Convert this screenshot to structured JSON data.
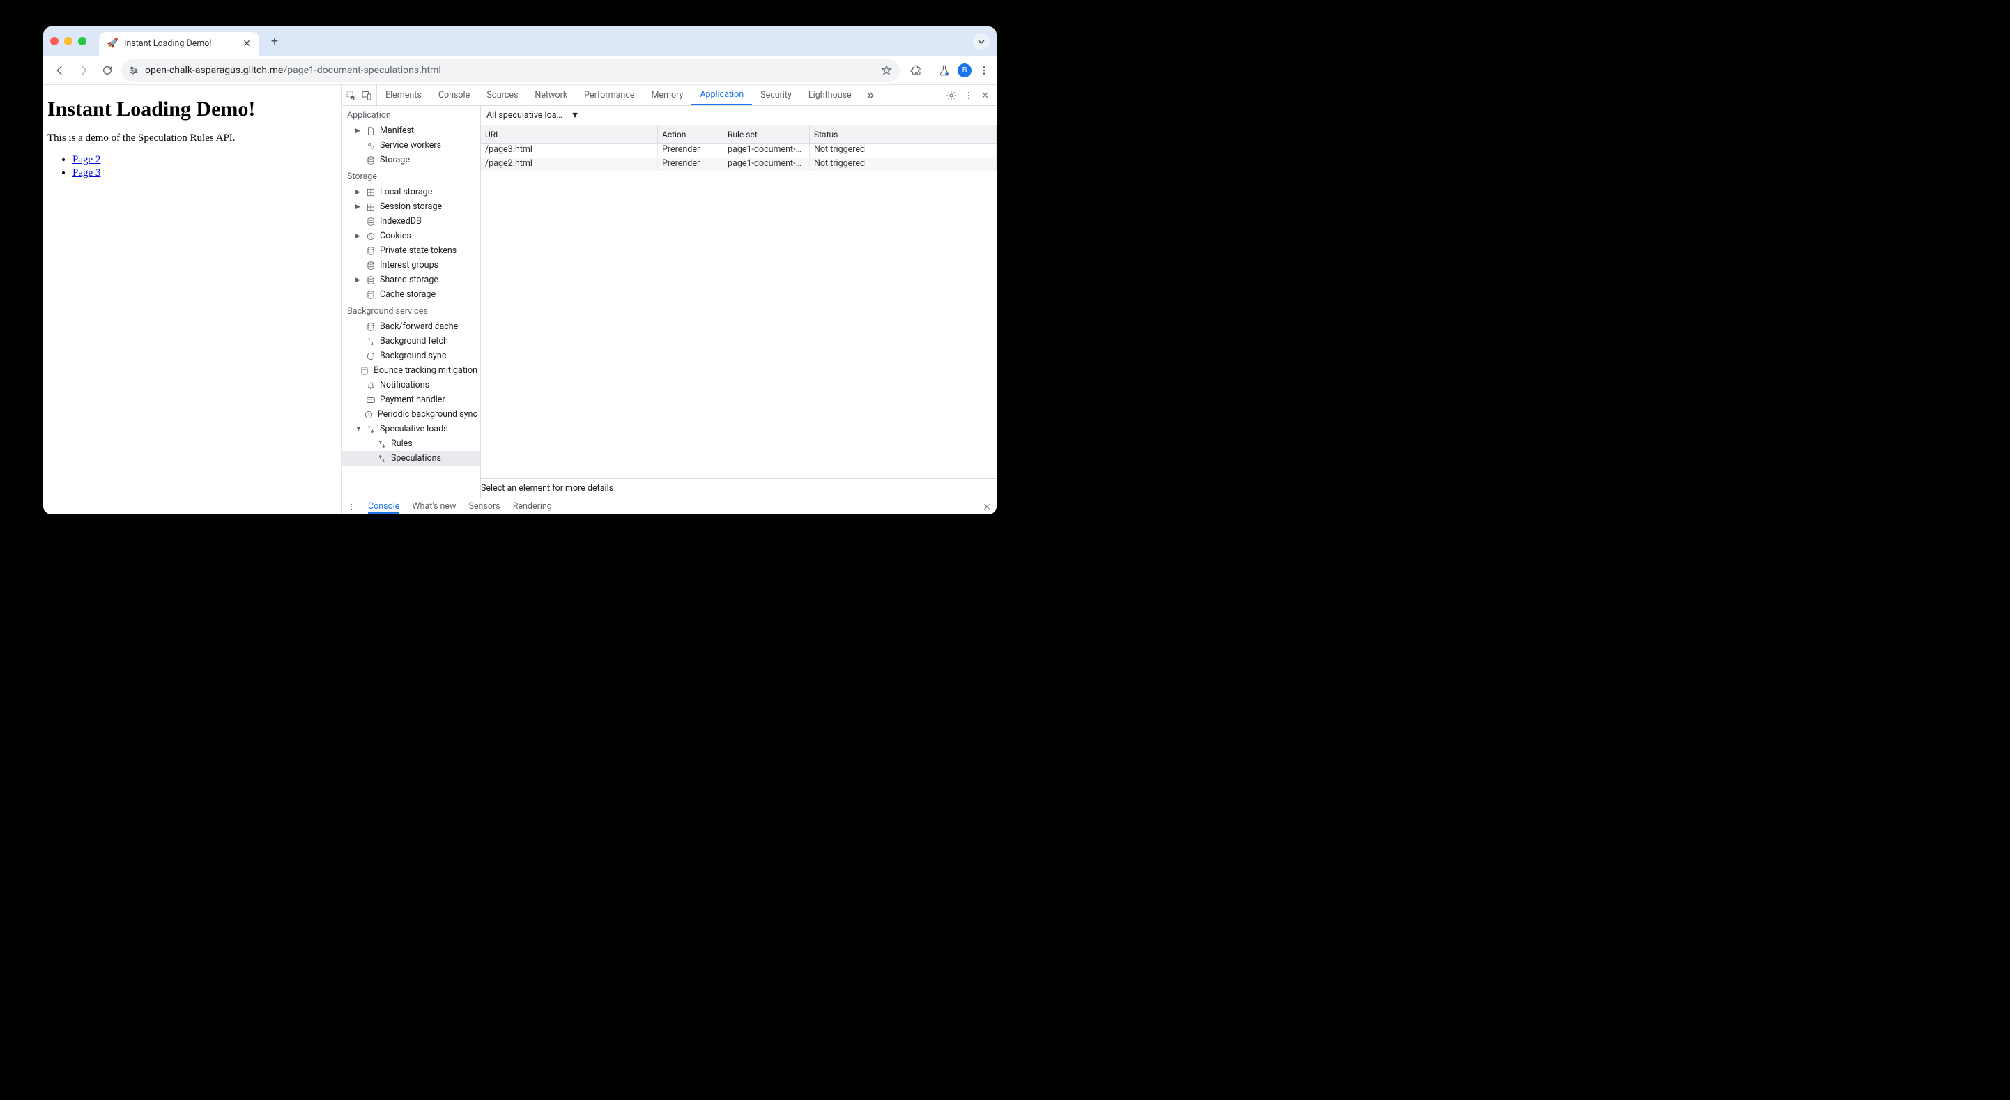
{
  "tab": {
    "title": "Instant Loading Demo!",
    "favicon": "🚀"
  },
  "omnibox": {
    "host": "open-chalk-asparagus.glitch.me",
    "path": "/page1-document-speculations.html"
  },
  "avatar_letter": "B",
  "page": {
    "heading": "Instant Loading Demo!",
    "paragraph": "This is a demo of the Speculation Rules API.",
    "links": [
      "Page 2",
      "Page 3"
    ]
  },
  "devtools": {
    "panels": [
      "Elements",
      "Console",
      "Sources",
      "Network",
      "Performance",
      "Memory",
      "Application",
      "Security",
      "Lighthouse"
    ],
    "active_panel": "Application",
    "sidebar": {
      "groups": [
        {
          "title": "Application",
          "items": [
            {
              "label": "Manifest",
              "icon": "file",
              "expandable": true
            },
            {
              "label": "Service workers",
              "icon": "gears"
            },
            {
              "label": "Storage",
              "icon": "db"
            }
          ]
        },
        {
          "title": "Storage",
          "items": [
            {
              "label": "Local storage",
              "icon": "grid",
              "expandable": true
            },
            {
              "label": "Session storage",
              "icon": "grid",
              "expandable": true
            },
            {
              "label": "IndexedDB",
              "icon": "db"
            },
            {
              "label": "Cookies",
              "icon": "cookie",
              "expandable": true
            },
            {
              "label": "Private state tokens",
              "icon": "db"
            },
            {
              "label": "Interest groups",
              "icon": "db"
            },
            {
              "label": "Shared storage",
              "icon": "db",
              "expandable": true
            },
            {
              "label": "Cache storage",
              "icon": "db"
            }
          ]
        },
        {
          "title": "Background services",
          "items": [
            {
              "label": "Back/forward cache",
              "icon": "db"
            },
            {
              "label": "Background fetch",
              "icon": "arrows"
            },
            {
              "label": "Background sync",
              "icon": "sync"
            },
            {
              "label": "Bounce tracking mitigation",
              "icon": "db"
            },
            {
              "label": "Notifications",
              "icon": "bell"
            },
            {
              "label": "Payment handler",
              "icon": "card"
            },
            {
              "label": "Periodic background sync",
              "icon": "clock"
            },
            {
              "label": "Speculative loads",
              "icon": "arrows",
              "expandable": true,
              "expanded": true,
              "children": [
                {
                  "label": "Rules",
                  "icon": "arrows"
                },
                {
                  "label": "Speculations",
                  "icon": "arrows",
                  "selected": true
                }
              ]
            }
          ]
        }
      ]
    },
    "filter_dropdown": "All speculative loa…",
    "columns": [
      "URL",
      "Action",
      "Rule set",
      "Status"
    ],
    "rows": [
      {
        "url": "/page3.html",
        "action": "Prerender",
        "ruleset": "page1-document-…",
        "status": "Not triggered"
      },
      {
        "url": "/page2.html",
        "action": "Prerender",
        "ruleset": "page1-document-…",
        "status": "Not triggered"
      }
    ],
    "detail_hint": "Select an element for more details",
    "drawer_tabs": [
      "Console",
      "What's new",
      "Sensors",
      "Rendering"
    ],
    "drawer_active": "Console"
  }
}
